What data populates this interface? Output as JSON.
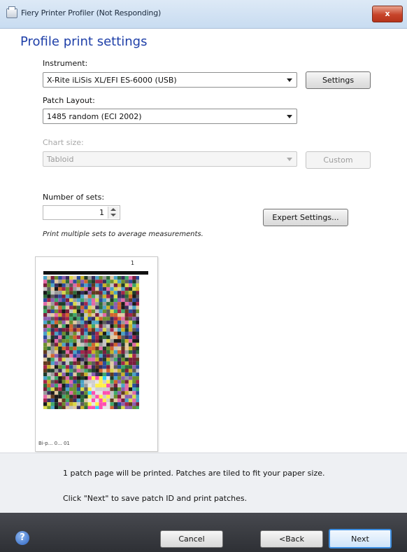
{
  "window": {
    "title": "Fiery Printer Profiler (Not Responding)",
    "close_label": "x"
  },
  "page": {
    "title": "Profile print settings"
  },
  "instrument": {
    "label": "Instrument:",
    "value": "X-Rite iLiSis XL/EFI ES-6000 (USB)",
    "settings_button": "Settings"
  },
  "patch_layout": {
    "label": "Patch Layout:",
    "value": "1485 random (ECI 2002)"
  },
  "chart_size": {
    "label": "Chart size:",
    "value": "Tabloid",
    "custom_button": "Custom"
  },
  "sets": {
    "label": "Number of sets:",
    "value": "1",
    "hint": "Print multiple sets to average measurements.",
    "expert_button": "Expert Settings..."
  },
  "preview": {
    "page_number": "1",
    "footer": "Bi-p... 0... 01"
  },
  "info": {
    "line1": "1 patch page will be printed. Patches are tiled to fit your paper size.",
    "line2": "Click \"Next\" to save patch ID and print patches."
  },
  "footer": {
    "help_label": "?",
    "cancel_label": "Cancel",
    "back_label": "<Back",
    "next_label": "Next"
  }
}
